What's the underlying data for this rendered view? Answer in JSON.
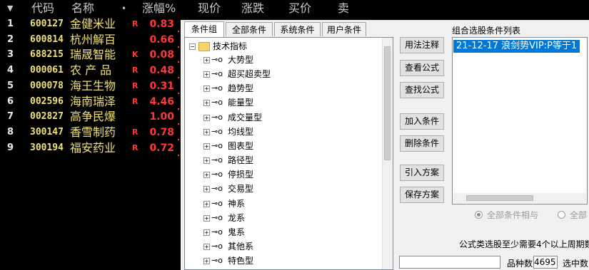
{
  "header": {
    "arrow": "▼",
    "code": "代码",
    "name": "名称",
    "dot": "•",
    "change_pct": "涨幅%",
    "price": "现价",
    "change": "涨跌",
    "bid": "买价",
    "ask": "卖"
  },
  "stocks": [
    {
      "idx": "1",
      "code": "600127",
      "name": "金健米业",
      "mark": "R",
      "pct": "0.83"
    },
    {
      "idx": "2",
      "code": "600814",
      "name": "杭州解百",
      "mark": "",
      "pct": "0.66"
    },
    {
      "idx": "3",
      "code": "688215",
      "name": "瑞晟智能",
      "mark": "K",
      "pct": "0.08"
    },
    {
      "idx": "4",
      "code": "000061",
      "name": "农 产 品",
      "mark": "R",
      "pct": "0.48"
    },
    {
      "idx": "5",
      "code": "000078",
      "name": "海王生物",
      "mark": "R",
      "pct": "0.31"
    },
    {
      "idx": "6",
      "code": "002596",
      "name": "海南瑞泽",
      "mark": "R",
      "pct": "4.46"
    },
    {
      "idx": "7",
      "code": "002827",
      "name": "高争民爆",
      "mark": "",
      "pct": "1.00"
    },
    {
      "idx": "8",
      "code": "300147",
      "name": "香雪制药",
      "mark": "R",
      "pct": "0.78"
    },
    {
      "idx": "9",
      "code": "300194",
      "name": "福安药业",
      "mark": "R",
      "pct": "0.72"
    }
  ],
  "dialog": {
    "tabs": [
      "条件组",
      "全部条件",
      "系统条件",
      "用户条件"
    ],
    "tree_root": "技术指标",
    "tree_items": [
      "大势型",
      "超买超卖型",
      "趋势型",
      "能量型",
      "成交量型",
      "均线型",
      "图表型",
      "路径型",
      "停损型",
      "交易型",
      "神系",
      "龙系",
      "鬼系",
      "其他系",
      "特色型"
    ],
    "buttons": {
      "usage": "用法注释",
      "view_formula": "查看公式",
      "find_formula": "查找公式",
      "add_condition": "加入条件",
      "delete_condition": "删除条件",
      "import_plan": "引入方案",
      "save_plan": "保存方案"
    },
    "combo_title": "组合选股条件列表",
    "combo_items": [
      "21-12-17 浪剑势VIP:P等于1"
    ],
    "radio_and": "全部条件相与",
    "radio_or": "全部",
    "tip": "公式类选股至少需要4个以上周期数",
    "count_label": "品种数",
    "count_value": "4695",
    "selected_label": "选中数"
  }
}
